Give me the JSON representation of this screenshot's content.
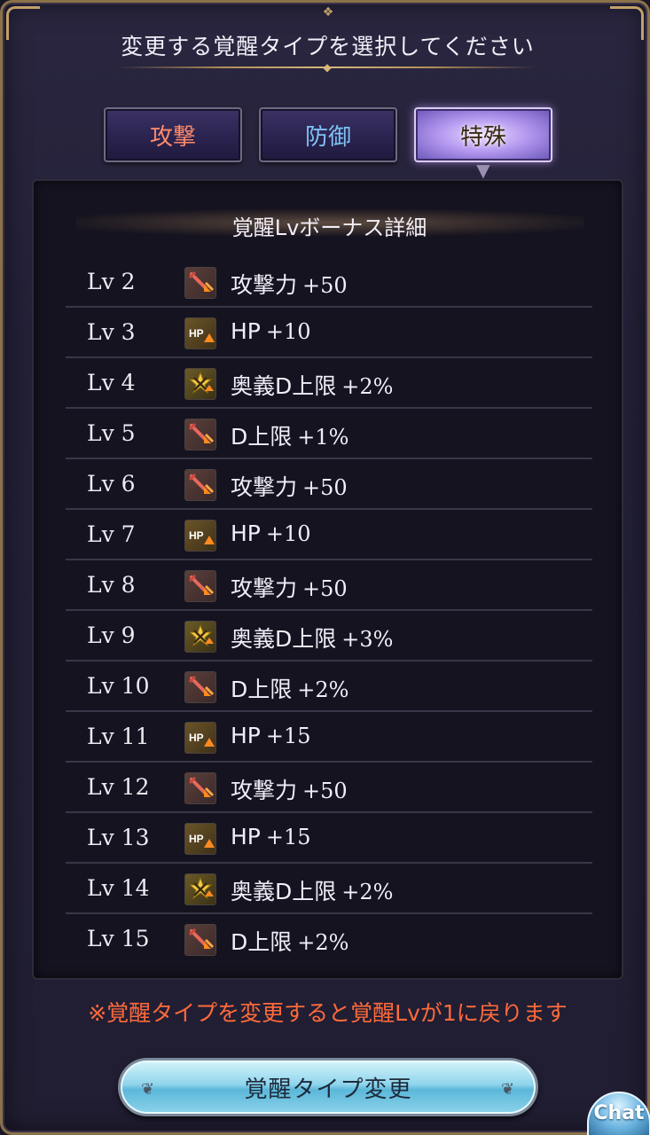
{
  "header": {
    "title": "変更する覚醒タイプを選択してください"
  },
  "tabs": [
    {
      "label": "攻撃",
      "selected": false,
      "color": "#ff8a6a"
    },
    {
      "label": "防御",
      "selected": false,
      "color": "#7fc2f2"
    },
    {
      "label": "特殊",
      "selected": true,
      "color": "#3a2a10"
    }
  ],
  "panel": {
    "title": "覚醒Lvボーナス詳細",
    "rows": [
      {
        "lv": "Lv 2",
        "icon": "attack-up-icon",
        "stat": "攻撃力",
        "value": "+50"
      },
      {
        "lv": "Lv 3",
        "icon": "hp-up-icon",
        "stat": "HP",
        "value": "+10"
      },
      {
        "lv": "Lv 4",
        "icon": "ougi-damage-cap-up-icon",
        "stat": "奥義D上限",
        "value": "+2%"
      },
      {
        "lv": "Lv 5",
        "icon": "attack-up-icon",
        "stat": "D上限",
        "value": "+1%"
      },
      {
        "lv": "Lv 6",
        "icon": "attack-up-icon",
        "stat": "攻撃力",
        "value": "+50"
      },
      {
        "lv": "Lv 7",
        "icon": "hp-up-icon",
        "stat": "HP",
        "value": "+10"
      },
      {
        "lv": "Lv 8",
        "icon": "attack-up-icon",
        "stat": "攻撃力",
        "value": "+50"
      },
      {
        "lv": "Lv 9",
        "icon": "ougi-damage-cap-up-icon",
        "stat": "奥義D上限",
        "value": "+3%"
      },
      {
        "lv": "Lv 10",
        "icon": "attack-up-icon",
        "stat": "D上限",
        "value": "+2%"
      },
      {
        "lv": "Lv 11",
        "icon": "hp-up-icon",
        "stat": "HP",
        "value": "+15"
      },
      {
        "lv": "Lv 12",
        "icon": "attack-up-icon",
        "stat": "攻撃力",
        "value": "+50"
      },
      {
        "lv": "Lv 13",
        "icon": "hp-up-icon",
        "stat": "HP",
        "value": "+15"
      },
      {
        "lv": "Lv 14",
        "icon": "ougi-damage-cap-up-icon",
        "stat": "奥義D上限",
        "value": "+2%"
      },
      {
        "lv": "Lv 15",
        "icon": "attack-up-icon",
        "stat": "D上限",
        "value": "+2%"
      }
    ]
  },
  "notice": "※覚醒タイプを変更すると覚醒Lvが1に戻ります",
  "change_button": {
    "label": "覚醒タイプ変更"
  },
  "chat_button": {
    "label": "Chat"
  },
  "colors": {
    "notice": "#ff6a3a",
    "attack_tab": "#ff8a6a",
    "defense_tab": "#7fc2f2",
    "frame_gold": "#8b7248"
  }
}
